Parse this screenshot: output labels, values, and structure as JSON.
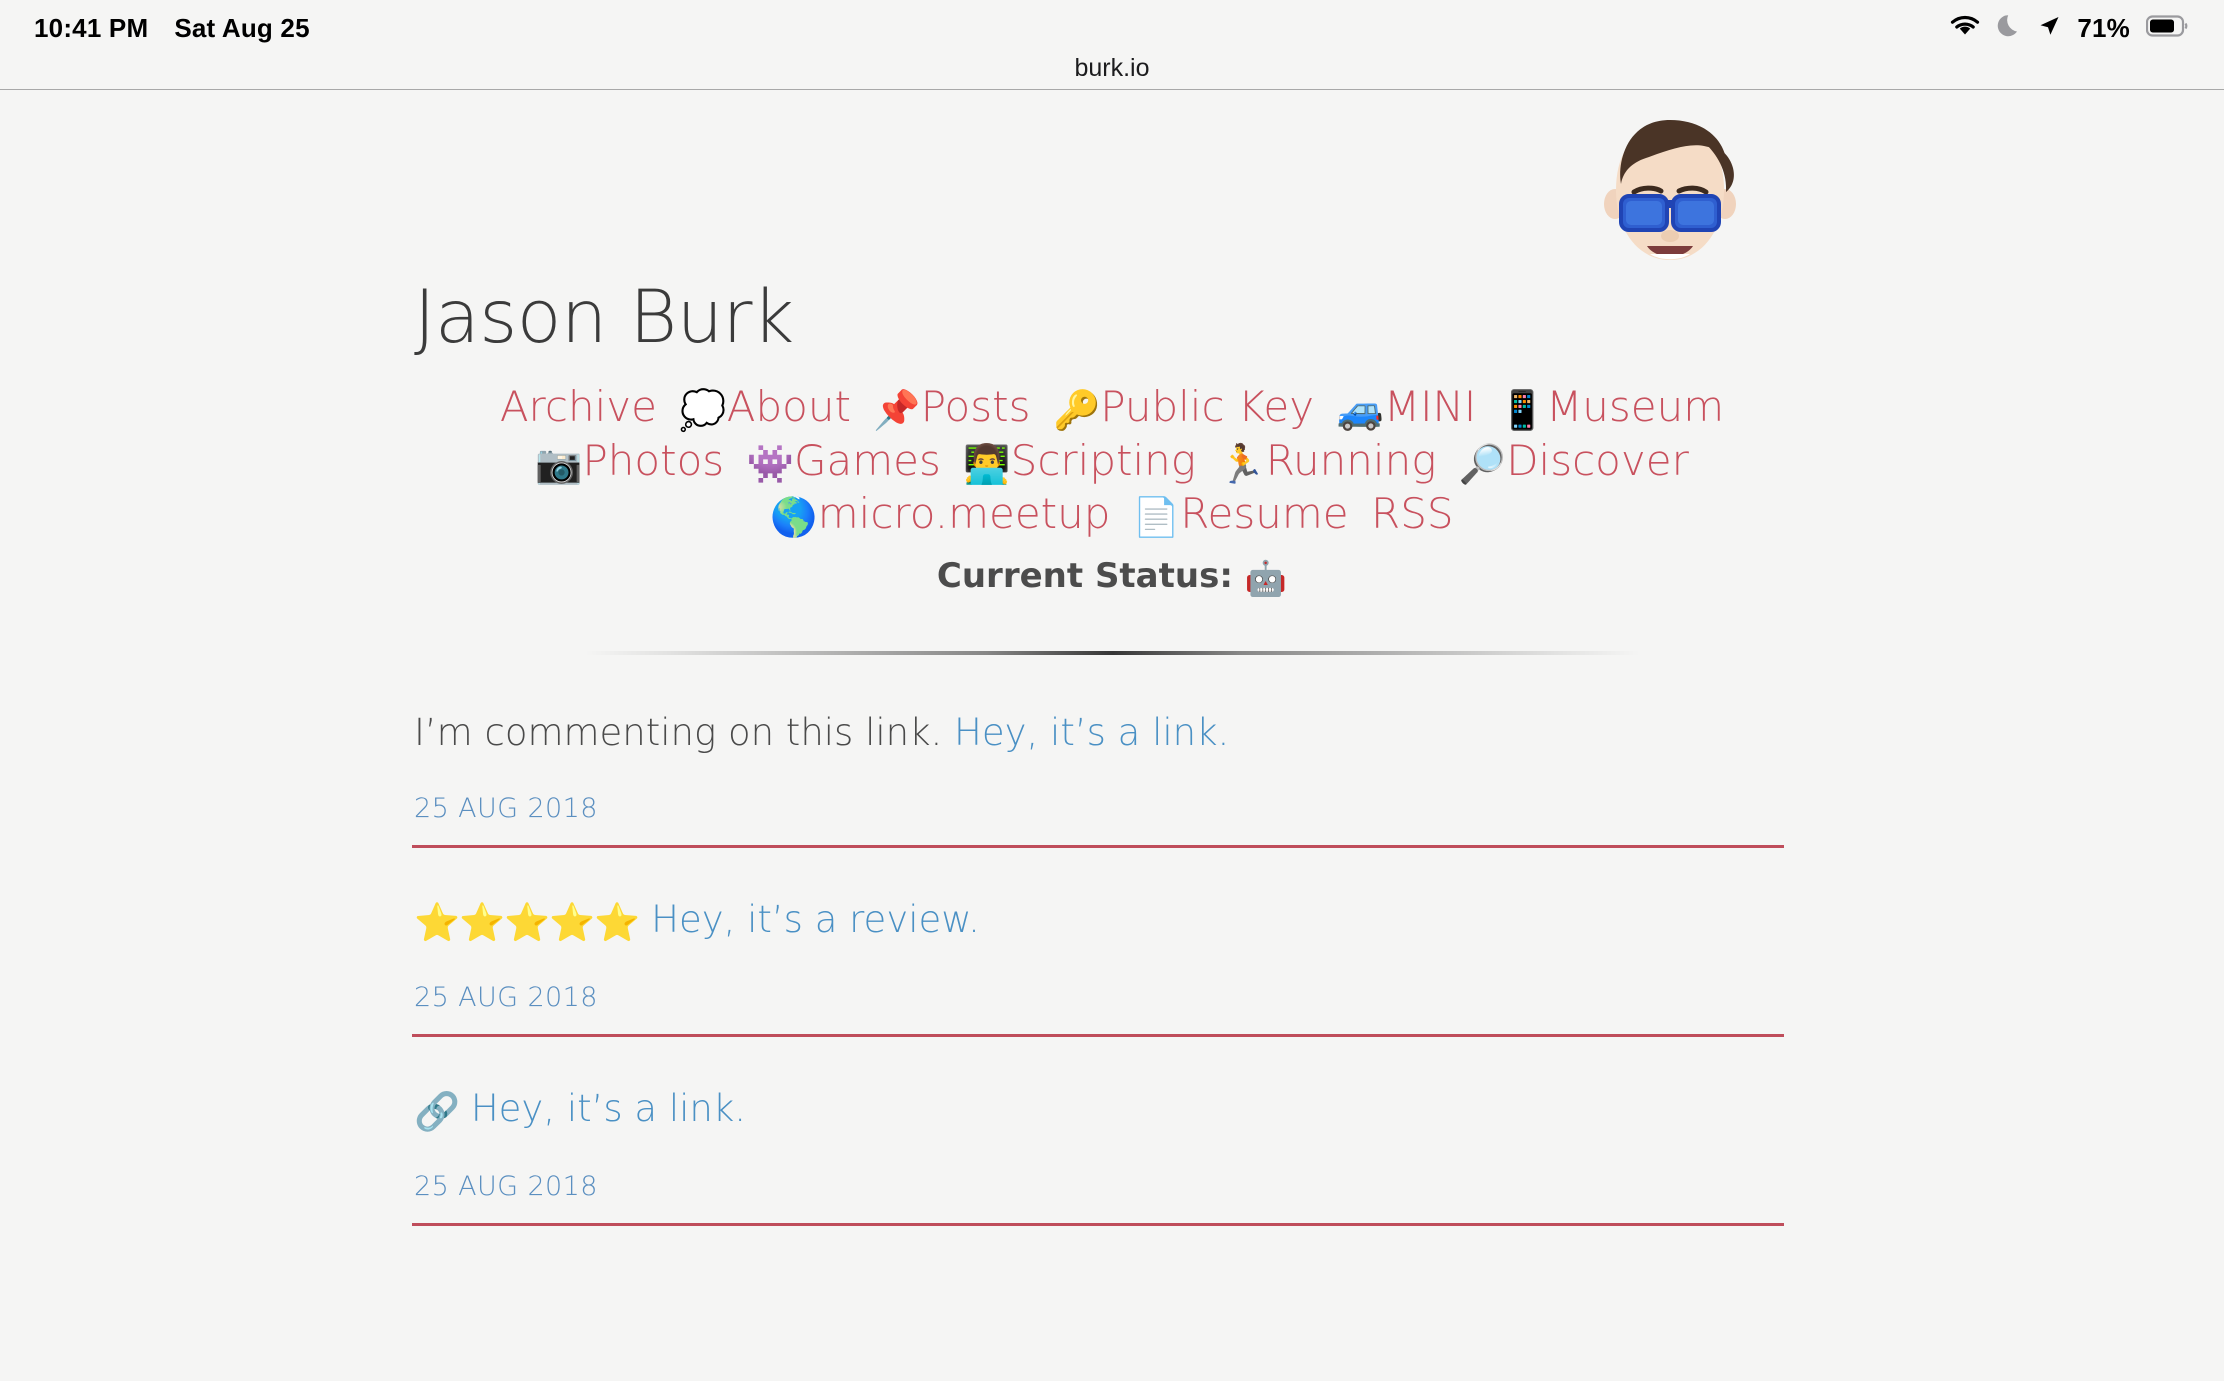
{
  "status_bar": {
    "time": "10:41 PM",
    "date": "Sat Aug 25",
    "battery_percent": "71%",
    "icons": [
      "wifi-icon",
      "do-not-disturb-moon-icon",
      "location-arrow-icon",
      "battery-icon"
    ]
  },
  "browser": {
    "url": "burk.io"
  },
  "header": {
    "avatar_alt": "memoji-avatar",
    "title": "Jason Burk",
    "status_label": "Current Status:",
    "status_emoji": "🤖"
  },
  "nav": {
    "items": [
      {
        "emoji": "",
        "label": "Archive"
      },
      {
        "emoji": "💭",
        "label": "About"
      },
      {
        "emoji": "📌",
        "label": "Posts"
      },
      {
        "emoji": "🔑",
        "label": "Public Key"
      },
      {
        "emoji": "🚙",
        "label": "MINI"
      },
      {
        "emoji": "📱",
        "label": "Museum"
      },
      {
        "emoji": "📷",
        "label": "Photos"
      },
      {
        "emoji": "👾",
        "label": "Games"
      },
      {
        "emoji": "👨‍💻",
        "label": "Scripting"
      },
      {
        "emoji": "🏃",
        "label": "Running"
      },
      {
        "emoji": "🔎",
        "label": "Discover"
      },
      {
        "emoji": "🌎",
        "label": "micro.meetup"
      },
      {
        "emoji": "📄",
        "label": "Resume"
      },
      {
        "emoji": "",
        "label": "RSS"
      }
    ]
  },
  "posts": [
    {
      "emoji": "",
      "plain_text": "I’m commenting on this link. ",
      "link_text": "Hey, it’s a link.",
      "date": "25 AUG 2018"
    },
    {
      "emoji": "⭐⭐⭐⭐⭐",
      "plain_text": "",
      "link_text": "Hey, it’s a review.",
      "date": "25 AUG 2018"
    },
    {
      "emoji": "🔗",
      "plain_text": "",
      "link_text": "Hey, it’s a link.",
      "date": "25 AUG 2018"
    }
  ],
  "colors": {
    "page_background": "#f5f5f4",
    "nav_link": "#c8515e",
    "post_link": "#4a90c4",
    "date_link": "#5b8fc0",
    "rule_red": "#bf4d5b",
    "title_text": "#3b3b3b"
  }
}
